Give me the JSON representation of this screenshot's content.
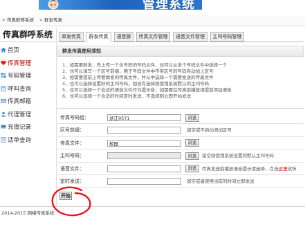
{
  "header": {
    "logo_text": "管理系统"
  },
  "breadcrumb": {
    "root": "传真群呼系统",
    "current": "群发传真"
  },
  "sidebar": {
    "title": "传真群呼系统",
    "active_index": 1,
    "items": [
      {
        "label": "首页",
        "icon": "home-icon"
      },
      {
        "label": "传真管理",
        "icon": "heart-icon"
      },
      {
        "label": "号码管理",
        "icon": "grid-icon"
      },
      {
        "label": "呼叫查询",
        "icon": "document-icon"
      },
      {
        "label": "传真邮箱",
        "icon": "mail-icon"
      },
      {
        "label": "代理管理",
        "icon": "users-icon"
      },
      {
        "label": "充值记录",
        "icon": "card-icon"
      },
      {
        "label": "话单查询",
        "icon": "list-icon"
      }
    ]
  },
  "tabs": [
    {
      "label": "单发传真",
      "active": false
    },
    {
      "label": "群发传真",
      "active": true
    },
    {
      "label": "语音群",
      "active": false
    },
    {
      "label": "传真文件管理",
      "active": false
    },
    {
      "label": "语音文件管理",
      "active": false
    },
    {
      "label": "主叫号码管理",
      "active": false
    }
  ],
  "notice": {
    "title": "群发传真使用须知",
    "lines": [
      "1、如需要群发，先上传一个含号码的号码文件，也可以从多个号码文件中选择一个",
      "2、也可以填写一个区号前缀，用于号码文件中不带区号的号码自动加上区号",
      "3、如需要提前上传要群发的传真文件，并从中选择一个需要发送的传真文件",
      "4、也可以选择设置好的主叫号码，如没有选择则使用系统默认的主叫号码",
      "5、也可以选择一个合适的语音文件作为提示音，如需要在传真前播放请提前添加语音",
      "6、也可以选择一个合适的时间定时发送，不选择则立即开始发送"
    ]
  },
  "form": {
    "browse_label": "浏览",
    "rows": [
      {
        "label": "传真号码组：",
        "value": "浙江0571"
      },
      {
        "label": "区号前缀：",
        "value": "",
        "hint": "留空或不自动添加区号"
      },
      {
        "label": "传真文件：",
        "value": "校园"
      },
      {
        "label": "主叫号码：",
        "value": "",
        "hint": "留空则使用系统设置的默认主叫号码"
      },
      {
        "label": "语音文件：",
        "value": "",
        "hint": "传真发送前播放语音提示请选择，点击",
        "hint_link": "这里",
        "hint_after": "试听"
      },
      {
        "label": "定时发送：",
        "value": "",
        "hint": "留空或者使用当前的时间立即发送"
      }
    ],
    "submit_label": "开始"
  },
  "footer": {
    "copyright": "2014-2015 网络传真系统"
  },
  "colors": {
    "accent": "#1f5fae",
    "link_red": "#e00000",
    "annotation_red": "#e8141b",
    "active_icon_red": "#d81b1b"
  }
}
